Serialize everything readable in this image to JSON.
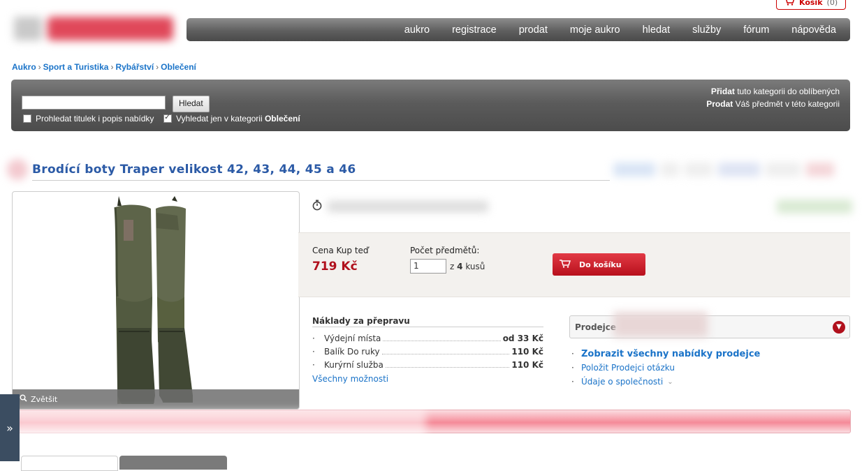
{
  "cart": {
    "label": "Košík",
    "count": "(0)"
  },
  "nav": [
    "aukro",
    "registrace",
    "prodat",
    "moje aukro",
    "hledat",
    "služby",
    "fórum",
    "nápověda"
  ],
  "breadcrumb": [
    "Aukro",
    "Sport a Turistika",
    "Rybářství",
    "Oblečení"
  ],
  "search": {
    "button": "Hledat",
    "opt1": "Prohledat titulek i popis nabídky",
    "opt2_prefix": "Vyhledat jen v kategorii ",
    "opt2_category": "Oblečení",
    "add_bold": "Přidat",
    "add_rest": " tuto kategorii do oblíbených",
    "sell_bold": "Prodat",
    "sell_rest": " Váš předmět v této kategorii"
  },
  "product": {
    "title": "Brodící boty Traper velikost 42, 43, 44, 45 a 46",
    "zoom": "Zvětšit",
    "price_label": "Cena Kup teď",
    "price": "719 Kč",
    "qty_label": "Počet předmětů:",
    "qty_value": "1",
    "qty_of": "z",
    "qty_total": "4",
    "qty_unit": "kusů",
    "add_to_cart": "Do košíku"
  },
  "shipping": {
    "heading": "Náklady za přepravu",
    "items": [
      {
        "name": "Výdejní místa",
        "price": "od 33 Kč"
      },
      {
        "name": "Balík Do ruky",
        "price": "110 Kč"
      },
      {
        "name": "Kurýrní služba",
        "price": "110 Kč"
      }
    ],
    "all": "Všechny možnosti"
  },
  "seller": {
    "label": "Prodejce",
    "links": [
      "Zobrazit všechny nabídky prodejce",
      "Položit Prodejci otázku",
      "Údaje o společnosti"
    ]
  },
  "colors": {
    "accent": "#b0101c",
    "link": "#1a73c8",
    "title": "#2b5aa6",
    "nav": "#5f5f5f"
  }
}
